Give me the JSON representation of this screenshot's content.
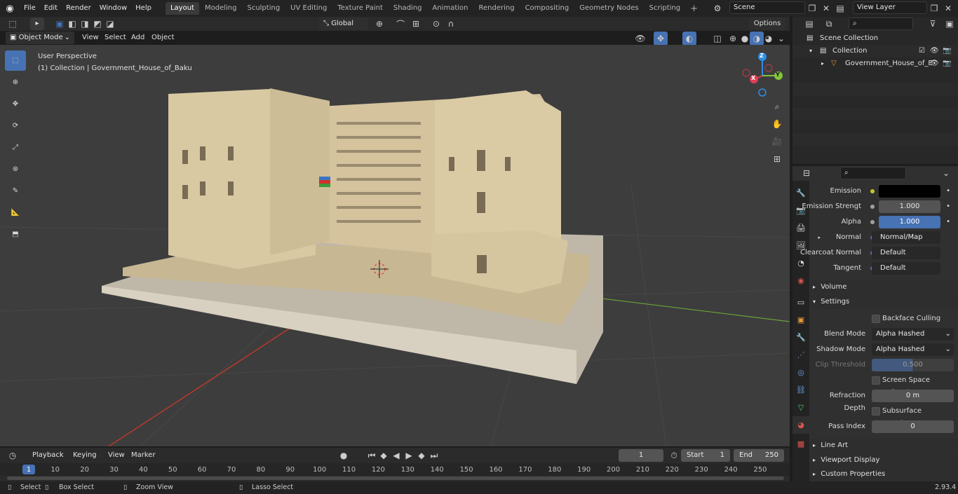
{
  "topbar": {
    "menus": [
      "File",
      "Edit",
      "Render",
      "Window",
      "Help"
    ],
    "workspaces": [
      "Layout",
      "Modeling",
      "Sculpting",
      "UV Editing",
      "Texture Paint",
      "Shading",
      "Animation",
      "Rendering",
      "Compositing",
      "Geometry Nodes",
      "Scripting"
    ],
    "active_workspace": "Layout",
    "add_symbol": "+",
    "scene": "Scene",
    "view_layer": "View Layer"
  },
  "viewport_header": {
    "mode": "Object Mode",
    "menus": [
      "View",
      "Select",
      "Add",
      "Object"
    ],
    "orientation": "Global",
    "options": "Options"
  },
  "viewport": {
    "perspective": "User Perspective",
    "collection_info": "(1) Collection | Government_House_of_Baku",
    "gizmo_axes": [
      "Z",
      "Y",
      "X"
    ]
  },
  "outliner": {
    "scene_collection": "Scene Collection",
    "collection": "Collection",
    "object": "Government_House_of_E"
  },
  "properties": {
    "emission_label": "Emission",
    "emission_strength_label": "Emission Strengt",
    "emission_strength": "1.000",
    "alpha_label": "Alpha",
    "alpha": "1.000",
    "normal_label": "Normal",
    "normal": "Normal/Map",
    "clearcoat_normal_label": "Clearcoat Normal",
    "clearcoat_normal": "Default",
    "tangent_label": "Tangent",
    "tangent": "Default",
    "volume": "Volume",
    "settings": "Settings",
    "backface_culling": "Backface Culling",
    "blend_mode_label": "Blend Mode",
    "blend_mode": "Alpha Hashed",
    "shadow_mode_label": "Shadow Mode",
    "shadow_mode": "Alpha Hashed",
    "clip_threshold_label": "Clip Threshold",
    "clip_threshold": "0.500",
    "screen_space_refraction": "Screen Space Refraction",
    "refraction_depth_label": "Refraction Depth",
    "refraction_depth": "0 m",
    "subsurface_translucency": "Subsurface Translucency",
    "pass_index_label": "Pass Index",
    "pass_index": "0",
    "line_art": "Line Art",
    "viewport_display": "Viewport Display",
    "custom_properties": "Custom Properties"
  },
  "timeline": {
    "menus": [
      "Playback",
      "Keying",
      "View",
      "Marker"
    ],
    "current_frame": "1",
    "start_label": "Start",
    "start": "1",
    "end_label": "End",
    "end": "250",
    "ticks": [
      "1",
      "10",
      "20",
      "30",
      "40",
      "50",
      "60",
      "70",
      "80",
      "90",
      "100",
      "110",
      "120",
      "130",
      "140",
      "150",
      "160",
      "170",
      "180",
      "190",
      "200",
      "210",
      "220",
      "230",
      "240",
      "250"
    ]
  },
  "statusbar": {
    "select": "Select",
    "box_select": "Box Select",
    "zoom_view": "Zoom View",
    "lasso_select": "Lasso Select",
    "version": "2.93.4"
  },
  "colors": {
    "accent": "#4772b3",
    "viewport_bg": "#3d3d3d",
    "building": "#d9c9a3",
    "x_axis": "#e03e54",
    "y_axis": "#82c43b",
    "z_axis": "#2e8ee6"
  }
}
